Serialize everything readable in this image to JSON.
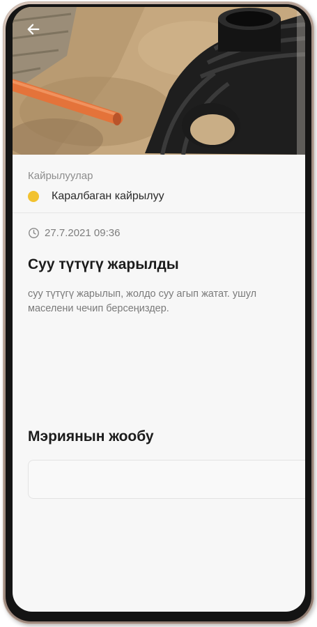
{
  "header": {
    "back_icon": "arrow-left-icon",
    "photo_alt": ""
  },
  "appeal": {
    "category_label": "Кайрылуулар",
    "status": {
      "text": "Каралбаган кайрылуу",
      "color": "#f2c230"
    },
    "date_icon": "clock-icon",
    "date": "27.7.2021 09:36",
    "title": "Суу түтүгү жарылды",
    "description": "суу түтүгү жарылып, жолдо суу агып жатат. ушул маселени чечип берсеңиздер."
  },
  "response": {
    "heading": "Мэриянын жообу",
    "text": ""
  }
}
